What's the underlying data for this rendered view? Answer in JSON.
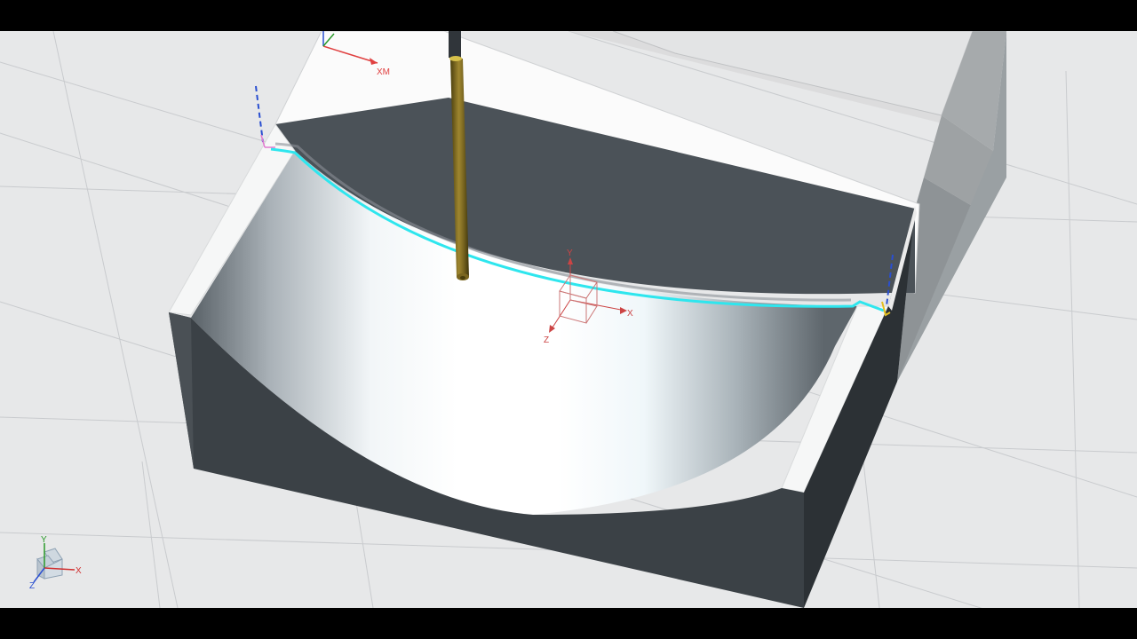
{
  "viewport": {
    "background": "#e7e8e9",
    "grid_color": "#c9cbce",
    "tool_path_color": "#2ee6ee"
  },
  "machine_csys": {
    "x_label": "XM",
    "axis_color": "#e04040"
  },
  "work_csys": {
    "x_label": "X",
    "y_label": "Y",
    "z_label": "Z",
    "axis_color": "#cc4444"
  },
  "view_triad": {
    "x_label": "X",
    "y_label": "Y",
    "z_label": "Z",
    "x_color": "#d03030",
    "y_color": "#2a9a2a",
    "z_color": "#2a4fd0"
  },
  "tool": {
    "icon": "end-mill-tool",
    "color": "#8a7420"
  }
}
